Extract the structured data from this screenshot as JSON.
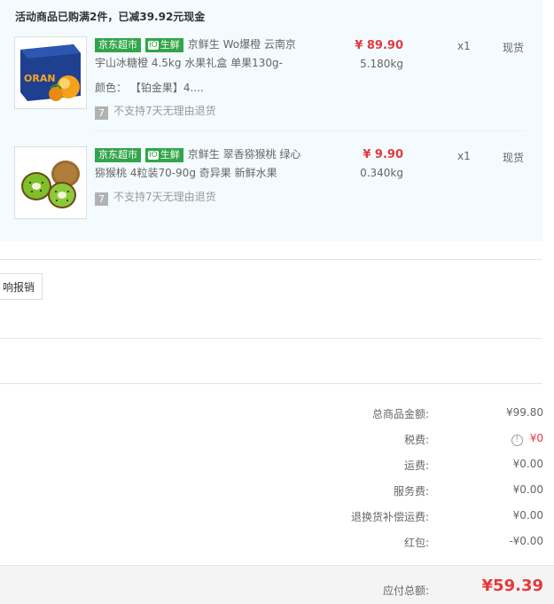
{
  "promo": {
    "title": "活动商品已购满2件，已减39.92元现金"
  },
  "items": [
    {
      "tag_market": "京东超市",
      "tag_fresh": "生鲜",
      "tag_fresh_icon": "fresh-tag-icon",
      "name": "京鲜生 Wo爆橙 云南京宇山冰糖橙 4.5kg 水果礼盒 单果130g-",
      "attr_label": "颜色：",
      "attr_value": "【铂金果】4....",
      "price": "¥ 89.90",
      "weight": "5.180kg",
      "qty": "x1",
      "stock": "现货",
      "no_return_icon": "7",
      "no_return": "不支持7天无理由退货",
      "image": "orange-gift-box"
    },
    {
      "tag_market": "京东超市",
      "tag_fresh": "生鲜",
      "tag_fresh_icon": "fresh-tag-icon",
      "name": "京鲜生 翠香猕猴桃 绿心猕猴桃 4粒装70-90g 奇异果 新鲜水果",
      "price": "¥ 9.90",
      "weight": "0.340kg",
      "qty": "x1",
      "stock": "现货",
      "no_return_icon": "7",
      "no_return": "不支持7天无理由退货",
      "image": "kiwi-fruit"
    }
  ],
  "invoice": {
    "button_label": "响报销"
  },
  "summary": {
    "rows": [
      {
        "label": "总商品金额:",
        "value": "¥99.80"
      },
      {
        "label": "税费:",
        "value": "¥0"
      },
      {
        "label": "运费:",
        "value": "¥0.00"
      },
      {
        "label": "服务费:",
        "value": "¥0.00"
      },
      {
        "label": "退换货补偿运费:",
        "value": "¥0.00"
      },
      {
        "label": "红包:",
        "value": "-¥0.00"
      }
    ],
    "total_label": "应付总额:",
    "total_value": "¥59.39"
  },
  "colors": {
    "accent_red": "#e4393c",
    "market_green": "#32a54a",
    "promo_bg": "#f3fbfe"
  }
}
